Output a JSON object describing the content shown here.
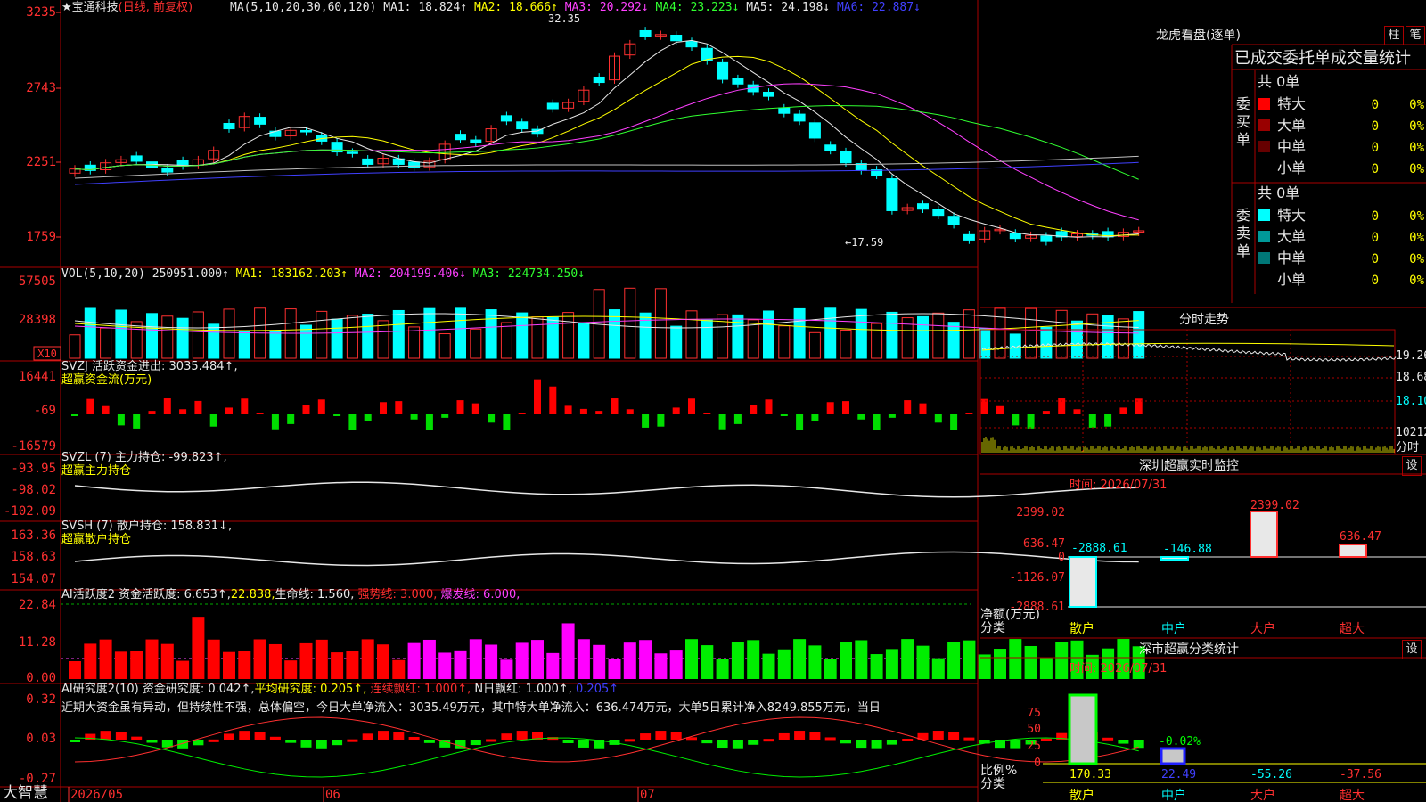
{
  "stock": {
    "name": "★宝通科技",
    "mode": "(日线, 前复权)"
  },
  "ma_header": {
    "label": "MA(5,10,20,30,60,120)",
    "ma1": "MA1: 18.824↑",
    "ma2": "MA2: 18.666↑",
    "ma3": "MA3: 20.292↓",
    "ma4": "MA4: 23.223↓",
    "ma5": "MA5: 24.198↓",
    "ma6": "MA6: 22.887↓"
  },
  "price_axis": [
    "3235",
    "2743",
    "2251",
    "1759"
  ],
  "price_marks": {
    "high": "32.35",
    "low": "17.59"
  },
  "vol": {
    "header": "VOL(5,10,20)",
    "value": "250951.000↑",
    "ma1": "MA1: 183162.203↑",
    "ma2": "MA2: 204199.406↓",
    "ma3": "MA3: 224734.250↓",
    "axis": [
      "57505",
      "28398"
    ],
    "unit": "X10"
  },
  "svzj": {
    "header": "SVZJ  活跃资金进出: 3035.484↑,",
    "sub": "超赢资金流(万元)",
    "axis": [
      "16441",
      "-69",
      "-16579"
    ]
  },
  "svzl": {
    "header": "SVZL (7) 主力持仓: -99.823↑,",
    "sub": "超赢主力持仓",
    "axis": [
      "-93.95",
      "-98.02",
      "-102.09"
    ]
  },
  "svsh": {
    "header": "SVSH (7) 散户持仓: 158.831↓,",
    "sub": "超赢散户持仓",
    "axis": [
      "163.36",
      "158.63",
      "154.07"
    ]
  },
  "ai_act": {
    "p1": "AI活跃度2 资金活跃度: 6.653↑,",
    "p2": "22.838,",
    "p3": "生命线: 1.560,",
    "p4": "强势线: 3.000,",
    "p5": "爆发线: 6.000,",
    "axis": [
      "22.84",
      "11.28",
      "0.00"
    ]
  },
  "ai_res": {
    "p1": "AI研究度2(10) 资金研究度: 0.042↑,",
    "p2": "平均研究度: 0.205↑,",
    "p3": "连续飘红: 1.000↑,",
    "p4": "N日飘红: 1.000↑,",
    "p5": "0.205↑",
    "text": "近期大资金虽有异动，但持续性不强，总体偏空，今日大单净流入：3035.49万元，其中特大单净流入：636.474万元，大单5日累计净入8249.855万元，当日",
    "axis": [
      "0.32",
      "0.03",
      "-0.27"
    ]
  },
  "dates": [
    "2026/05",
    "06",
    "07"
  ],
  "brand": "大智慧",
  "right": {
    "lh_title": "龙虎看盘(逐单)",
    "btn1": "柱",
    "btn2": "笔",
    "order_title": "已成交委托单成交量统计",
    "buy_label": "委买单",
    "sell_label": "委卖单",
    "buy_total": "共 0单",
    "sell_total": "共 0单",
    "rows": [
      "特大",
      "大单",
      "中单",
      "小单"
    ],
    "zero": "0",
    "pct": "0%",
    "buy_colors": [
      "#ff0000",
      "#990000",
      "#660000",
      ""
    ],
    "sell_colors": [
      "#00ffff",
      "#009999",
      "#007777",
      ""
    ],
    "fs_title": "分时走势",
    "fs_axis": [
      "19.26",
      "18.68",
      "18.10",
      "10212",
      "分时"
    ],
    "sz_title": "深圳超赢实时监控",
    "sz_btn": "设",
    "sz_time": "时间: 2026/07/31",
    "sz_axis": [
      "2399.02",
      "636.47",
      "0",
      "-1126.07",
      "-2888.61"
    ],
    "sz_ylabel": "净额(万元)",
    "sz_xlabel": "分类",
    "sz_cats": [
      "散户",
      "中户",
      "大户",
      "超大"
    ],
    "sz_vals_text": [
      "-2888.61",
      "-146.88",
      "2399.02",
      "636.47"
    ],
    "ss_title": "深市超赢分类统计",
    "ss_btn": "设",
    "ss_time": "时间: 2026/07/31",
    "ss_axis": [
      "75",
      "50",
      "25",
      "0"
    ],
    "ss_pct_label": "-0.02%",
    "ss_ylabel": "比例%",
    "ss_xlabel": "分类",
    "ss_vals_text": [
      "170.33",
      "22.49",
      "-55.26",
      "-37.56"
    ],
    "ss_cats": [
      "散户",
      "中户",
      "大户",
      "超大"
    ]
  },
  "chart_data": [
    {
      "type": "candlestick",
      "title": "宝通科技 日线",
      "ylim": [
        17.59,
        32.35
      ],
      "series": [
        {
          "name": "close",
          "values": [
            22.9,
            22.8,
            23.3,
            23.5,
            23.4,
            23.0,
            22.7,
            23.1,
            23.5,
            24.1,
            25.5,
            26.3,
            25.8,
            25.0,
            25.4,
            25.3,
            24.7,
            24.0,
            23.9,
            23.2,
            23.6,
            23.2,
            23.0,
            23.4,
            24.5,
            24.8,
            24.6,
            25.5,
            26.0,
            25.5,
            25.2,
            26.8,
            27.2,
            28.0,
            28.5,
            30.2,
            31.0,
            31.5,
            31.6,
            31.2,
            30.8,
            29.9,
            28.7,
            28.4,
            27.9,
            27.6,
            26.5,
            26.0,
            24.9,
            24.1,
            23.3,
            22.8,
            22.5,
            20.2,
            20.4,
            20.3,
            19.9,
            19.3,
            18.3,
            18.9,
            19.0,
            18.4,
            18.6,
            18.2,
            18.5,
            18.7,
            18.6,
            18.5,
            18.8,
            18.9
          ]
        }
      ]
    },
    {
      "type": "bar",
      "title": "VOL(5,10,20)",
      "series": [
        {
          "name": "VOL",
          "values": [
            250951
          ]
        }
      ]
    }
  ]
}
